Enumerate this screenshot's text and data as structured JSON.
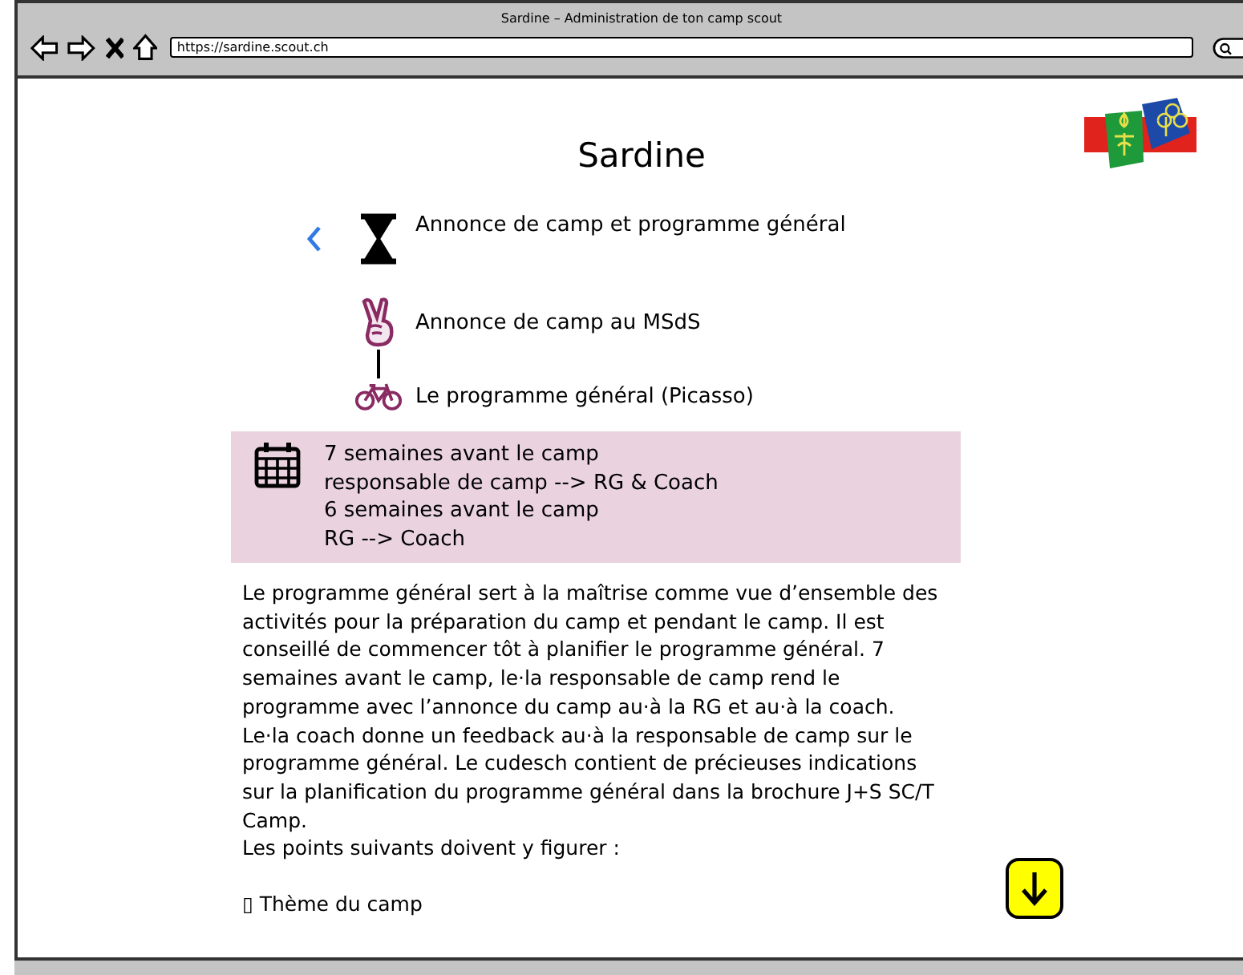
{
  "window": {
    "title": "Sardine – Administration de ton camp scout"
  },
  "address_bar": {
    "value": "https://sardine.scout.ch"
  },
  "page": {
    "title": "Sardine",
    "steps": [
      {
        "kind": "hourglass",
        "label": "Annonce de camp et programme général",
        "connector": false
      },
      {
        "kind": "victory",
        "label": "Annonce de camp au MSdS",
        "connector": true
      },
      {
        "kind": "bicycle",
        "label": "Le programme général (Picasso)",
        "connector": false
      }
    ],
    "deadline_box": {
      "lines": [
        "7 semaines avant le camp",
        "responsable de camp --> RG & Coach",
        "6 semaines avant le camp",
        "RG --> Coach"
      ]
    },
    "description": "Le programme général sert à la maîtrise comme vue d’ensemble des activités pour la préparation du camp et pendant le camp. Il est conseillé de commencer tôt à planifier le programme général. 7 semaines avant le camp, le·la responsable de camp rend le programme avec l’annonce du camp au·à la RG et au·à la coach. Le·la coach donne un feedback au·à la responsable de camp sur le programme général. Le cudesch contient de précieuses indications sur la planification du programme général dans la brochure J+S SC/T Camp.",
    "points_intro": "Les points suivants doivent y figurer :",
    "points": [
      "▯ Thème du camp"
    ]
  }
}
